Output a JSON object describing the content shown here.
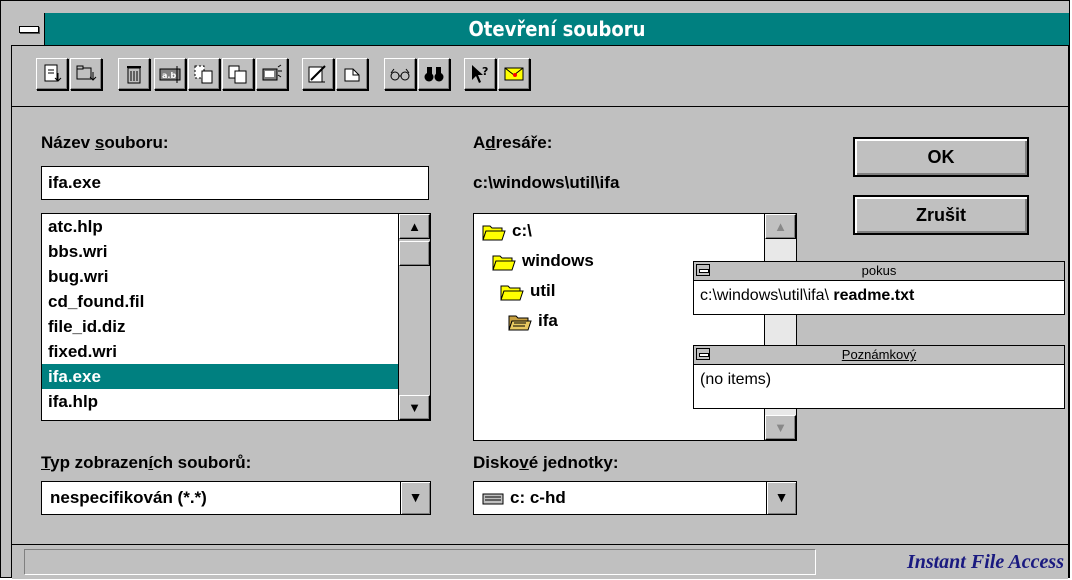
{
  "window": {
    "title": "Otevření souboru"
  },
  "toolbar": {
    "buttons": [
      "new-file",
      "open-folder",
      "delete",
      "rename",
      "copy",
      "duplicate",
      "move",
      "edit",
      "print",
      "view",
      "find",
      "help",
      "info"
    ]
  },
  "file": {
    "label_prefix": "Název ",
    "label_accel": "s",
    "label_suffix": "ouboru:",
    "value": "ifa.exe",
    "items": [
      "atc.hlp",
      "bbs.wri",
      "bug.wri",
      "cd_found.fil",
      "file_id.diz",
      "fixed.wri",
      "ifa.exe",
      "ifa.hlp"
    ],
    "selected_index": 6
  },
  "dirs": {
    "label_prefix": "A",
    "label_accel": "d",
    "label_suffix": "resáře:",
    "path": "c:\\windows\\util\\ifa",
    "items": [
      "c:\\",
      "windows",
      "util",
      "ifa"
    ]
  },
  "type": {
    "label_accel": "T",
    "label_mid": "yp zobrazen",
    "label_accel2": "í",
    "label_suffix": "ch souborů:",
    "value": "nespecifikován (*.*)"
  },
  "drives": {
    "label_prefix": "Disko",
    "label_accel": "v",
    "label_suffix": "é jednotky:",
    "value": "c: c-hd"
  },
  "buttons": {
    "ok": "OK",
    "cancel": "Zrušit"
  },
  "pokus": {
    "title": "pokus",
    "path": "c:\\windows\\util\\ifa\\ ",
    "file": "readme.txt"
  },
  "poznamkovy": {
    "title": "Poznámkový",
    "value": "(no items)"
  },
  "status": {
    "brand": "Instant File Access"
  }
}
